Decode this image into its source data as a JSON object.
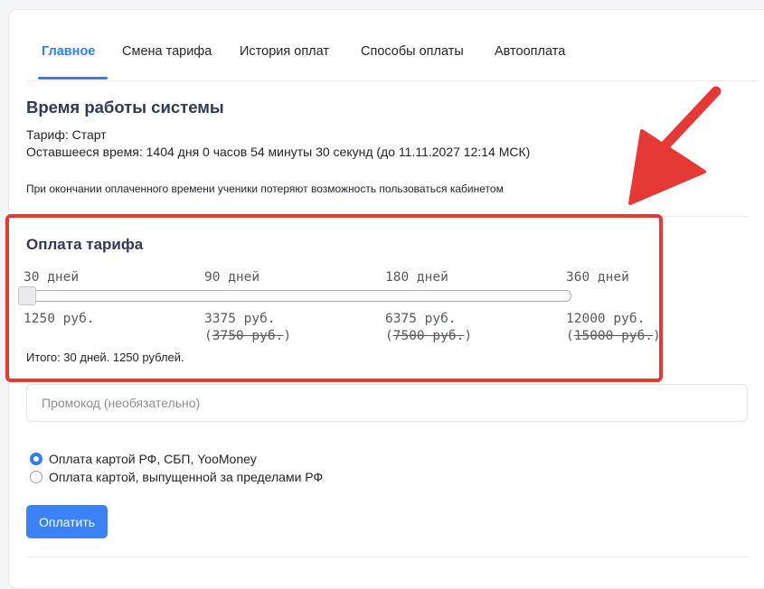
{
  "tabs": [
    {
      "label": "Главное",
      "active": true
    },
    {
      "label": "Смена тарифа",
      "active": false
    },
    {
      "label": "История оплат",
      "active": false
    },
    {
      "label": "Способы оплаты",
      "active": false
    },
    {
      "label": "Автооплата",
      "active": false
    }
  ],
  "system": {
    "title": "Время работы системы",
    "tariff": "Тариф: Старт",
    "remaining": "Оставшееся время: 1404 дня 0 часов 54 минуты 30 секунд (до 11.11.2027 12:14 МСК)",
    "note": "При окончании оплаченного времени ученики потеряют возможность пользоваться кабинетом"
  },
  "payment": {
    "title": "Оплата тарифа",
    "options": [
      {
        "period": "30 дней",
        "price": "1250 руб.",
        "old_price": ""
      },
      {
        "period": "90 дней",
        "price": "3375 руб.",
        "old_price": "3750 руб."
      },
      {
        "period": "180 дней",
        "price": "6375 руб.",
        "old_price": "7500 руб."
      },
      {
        "period": "360 дней",
        "price": "12000 руб.",
        "old_price": "15000 руб."
      }
    ],
    "slider_selected_index": 0,
    "total": "Итого: 30 дней. 1250 рублей."
  },
  "promo": {
    "placeholder": "Промокод (необязательно)",
    "value": ""
  },
  "methods": [
    {
      "label": "Оплата картой РФ, СБП, YooMoney",
      "checked": true
    },
    {
      "label": "Оплата картой, выпущенной за пределами РФ",
      "checked": false
    }
  ],
  "pay_button": "Оплатить",
  "colors": {
    "accent": "#2f80ed",
    "highlight": "#e53935",
    "button": "#3b82f6"
  }
}
